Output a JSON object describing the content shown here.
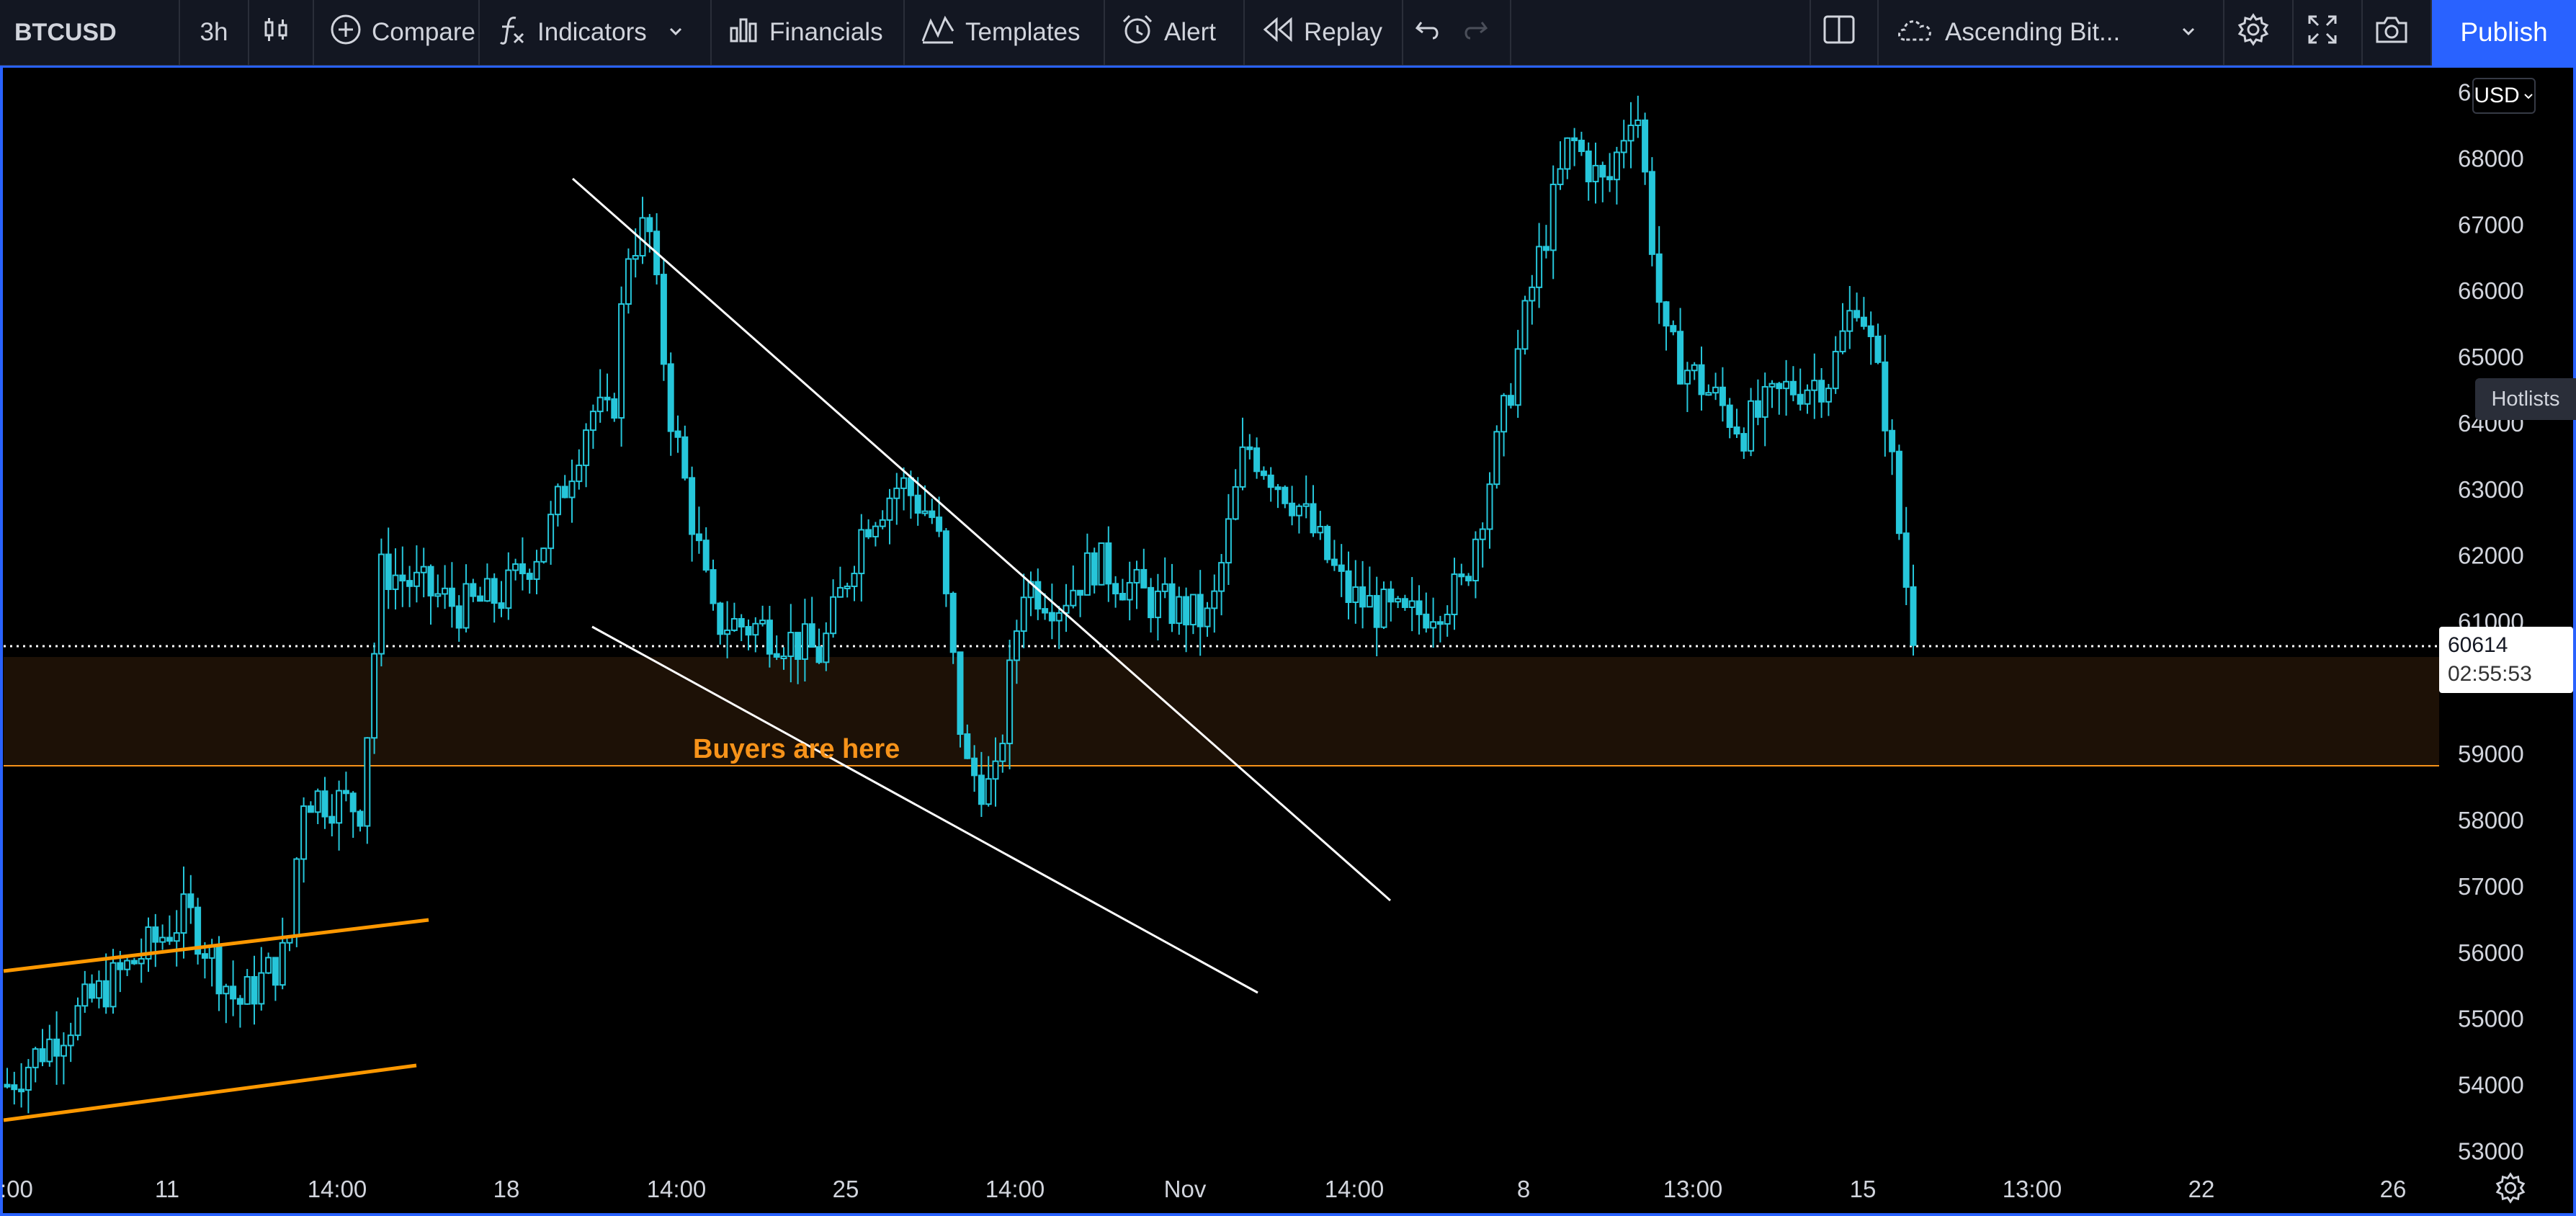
{
  "toolbar": {
    "symbol": "BTCUSD",
    "interval": "3h",
    "compare_label": "Compare",
    "indicators_label": "Indicators",
    "financials_label": "Financials",
    "templates_label": "Templates",
    "alert_label": "Alert",
    "replay_label": "Replay",
    "layout_name": "Ascending Bit...",
    "publish_label": "Publish"
  },
  "price_scale": {
    "currency": "USD",
    "hotlists_label": "Hotlists",
    "ticks": [
      "6",
      "68000",
      "67000",
      "66000",
      "65000",
      "64000",
      "63000",
      "62000",
      "61000",
      "59000",
      "58000",
      "57000",
      "56000",
      "55000",
      "54000",
      "53000"
    ],
    "last_price": "60614",
    "countdown": "02:55:53"
  },
  "time_axis": {
    "ticks": [
      ":00",
      "11",
      "14:00",
      "18",
      "14:00",
      "25",
      "14:00",
      "Nov",
      "14:00",
      "8",
      "13:00",
      "15",
      "13:00",
      "22",
      "26"
    ]
  },
  "annotations": {
    "zone_label": "Buyers are here"
  },
  "colors": {
    "accent": "#2962ff",
    "candle": "#26c6da",
    "zone_fill": "#1d1106",
    "zone_edge": "#f7931a",
    "label": "#f7931a",
    "trendline": "#ffffff",
    "channel": "#ff9800"
  },
  "chart_data": {
    "type": "candlestick",
    "symbol": "BTCUSD",
    "interval": "3h",
    "y_range": [
      52700,
      69300
    ],
    "last_price": 60614,
    "key_points": [
      {
        "t": "Oct 10 00:00",
        "close": 54000
      },
      {
        "t": "Oct 12 22:00",
        "close": 58400
      },
      {
        "t": "Oct 15",
        "close": 61800
      },
      {
        "t": "Oct 20",
        "close": 64200
      },
      {
        "t": "Oct 21",
        "high": 67000
      },
      {
        "t": "Oct 24",
        "close": 61000
      },
      {
        "t": "Oct 26",
        "close": 63400
      },
      {
        "t": "Oct 28",
        "low": 58100
      },
      {
        "t": "Nov 3",
        "close": 63800
      },
      {
        "t": "Nov 6",
        "close": 61000
      },
      {
        "t": "Nov 9",
        "high": 68500
      },
      {
        "t": "Nov 10",
        "high": 69000
      },
      {
        "t": "Nov 12",
        "close": 64700
      },
      {
        "t": "Nov 15",
        "close": 66000
      },
      {
        "t": "Nov 16",
        "close": 60614
      }
    ],
    "zones": [
      {
        "label": "Buyers are here",
        "from": 58800,
        "to": 60500
      }
    ]
  }
}
